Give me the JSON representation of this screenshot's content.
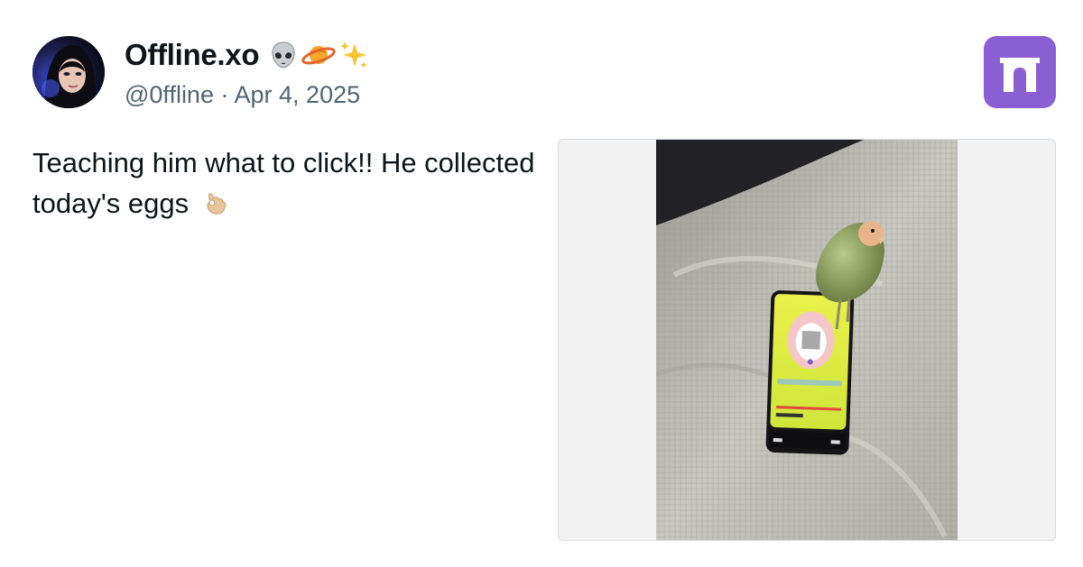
{
  "post": {
    "display_name": "Offline.xo",
    "name_emoji_icons": [
      "alien-icon",
      "ringed-planet-icon",
      "sparkles-icon"
    ],
    "handle": "@0ffline",
    "separator": "·",
    "date": "Apr 4, 2025",
    "text": "Teaching him what to click!! He collected today's eggs",
    "text_emoji_icon": "ok-hand-icon"
  },
  "media": {
    "description_icon": "photo-parrot-on-phone"
  },
  "colors": {
    "brand_logo": "#8b5fd4",
    "meta_text": "#536471",
    "body_text": "#0f1419"
  }
}
